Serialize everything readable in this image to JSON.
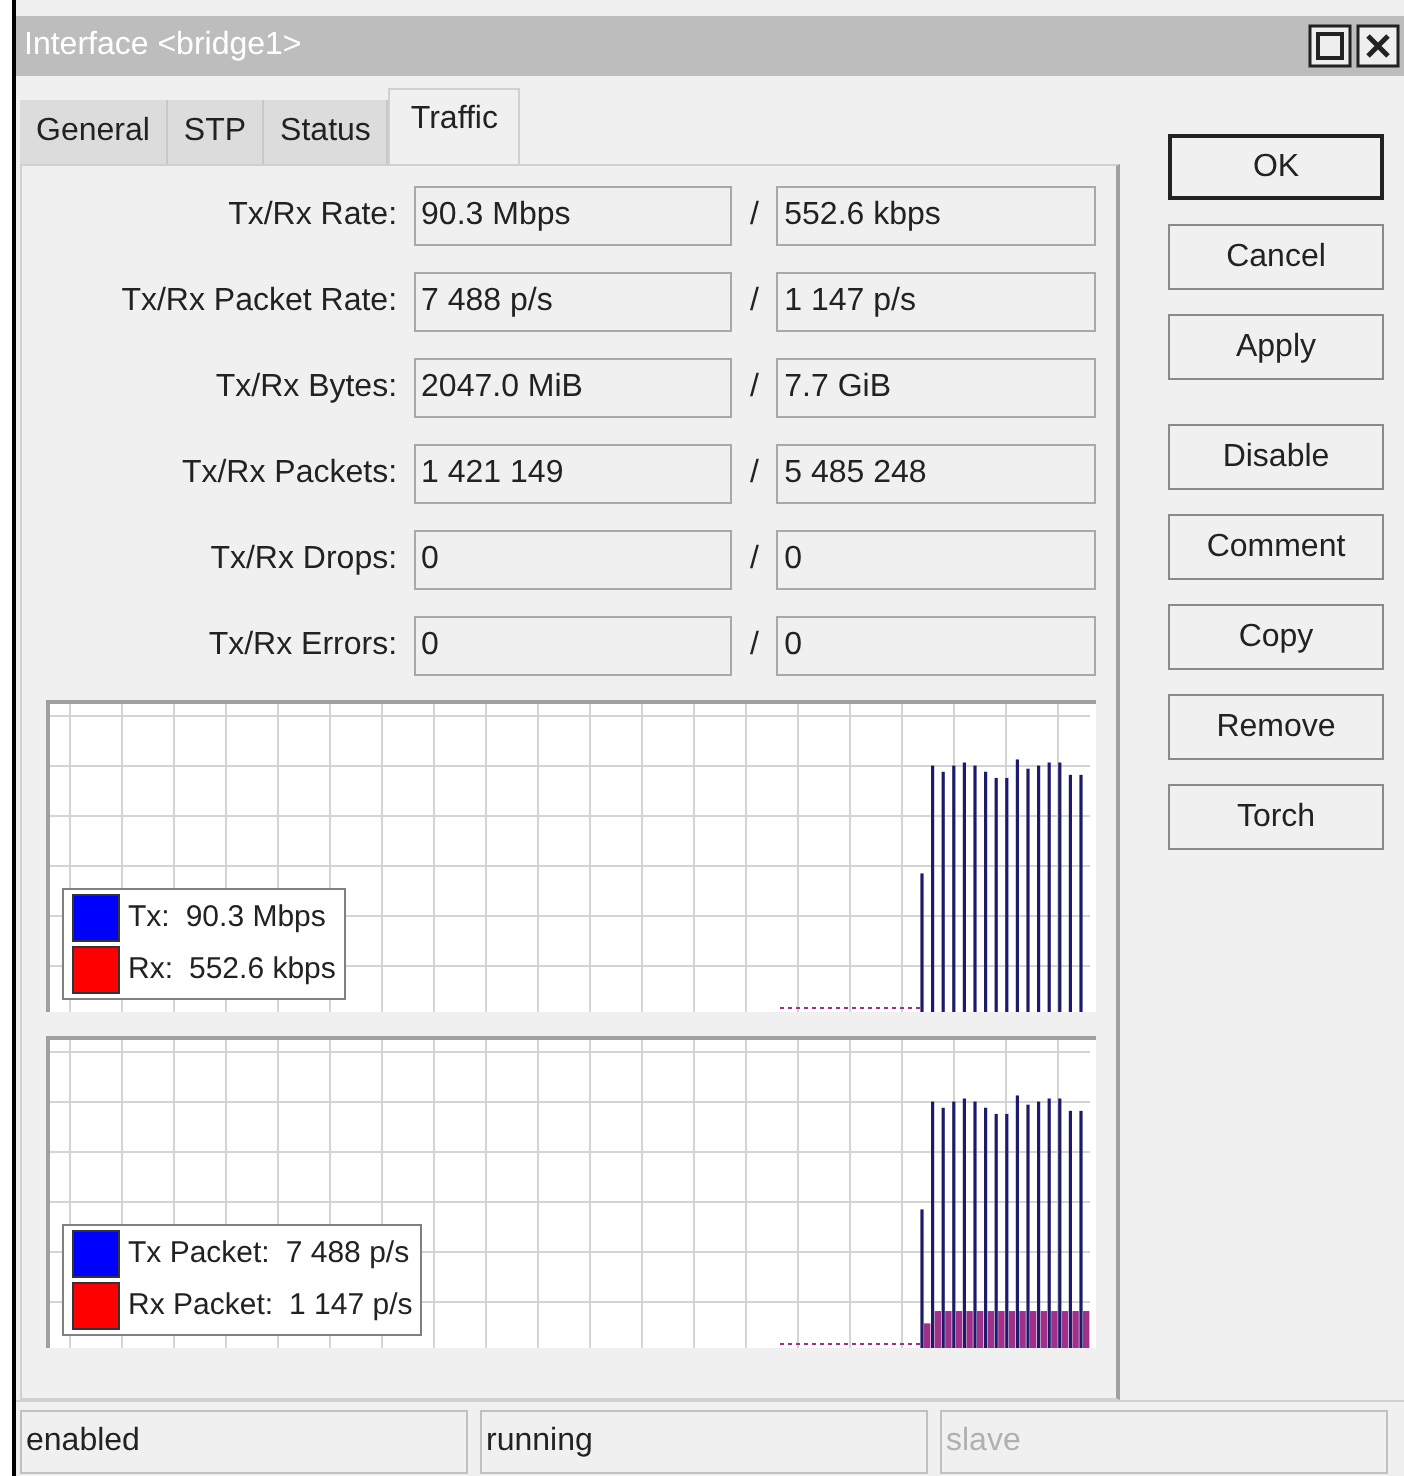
{
  "window": {
    "title": "Interface <bridge1>"
  },
  "tabs": [
    {
      "label": "General",
      "selected": false
    },
    {
      "label": "STP",
      "selected": false
    },
    {
      "label": "Status",
      "selected": false
    },
    {
      "label": "Traffic",
      "selected": true
    }
  ],
  "fields": [
    {
      "label": "Tx/Rx Rate:",
      "tx": "90.3 Mbps",
      "separator": "/",
      "rx": "552.6 kbps"
    },
    {
      "label": "Tx/Rx Packet Rate:",
      "tx": "7 488 p/s",
      "separator": "/",
      "rx": "1 147 p/s"
    },
    {
      "label": "Tx/Rx Bytes:",
      "tx": "2047.0 MiB",
      "separator": "/",
      "rx": "7.7 GiB"
    },
    {
      "label": "Tx/Rx Packets:",
      "tx": "1 421 149",
      "separator": "/",
      "rx": "5 485 248"
    },
    {
      "label": "Tx/Rx Drops:",
      "tx": "0",
      "separator": "/",
      "rx": "0"
    },
    {
      "label": "Tx/Rx Errors:",
      "tx": "0",
      "separator": "/",
      "rx": "0"
    }
  ],
  "graphs": [
    {
      "kind": "rate",
      "legend": [
        {
          "label": "Tx:",
          "value": "90.3 Mbps",
          "color": "#0000ff"
        },
        {
          "label": "Rx:",
          "value": "552.6 kbps",
          "color": "#ff0000"
        }
      ]
    },
    {
      "kind": "packets",
      "legend": [
        {
          "label": "Tx Packet:",
          "value": "7 488 p/s",
          "color": "#0000ff"
        },
        {
          "label": "Rx Packet:",
          "value": "1 147 p/s",
          "color": "#ff0000"
        }
      ]
    }
  ],
  "buttons": [
    {
      "label": "OK",
      "default": true
    },
    {
      "label": "Cancel",
      "default": false
    },
    {
      "label": "Apply",
      "default": false
    },
    {
      "label": "Disable",
      "default": false
    },
    {
      "label": "Comment",
      "default": false
    },
    {
      "label": "Copy",
      "default": false
    },
    {
      "label": "Remove",
      "default": false
    },
    {
      "label": "Torch",
      "default": false
    }
  ],
  "status_bar": [
    {
      "text": "enabled",
      "disabled": false
    },
    {
      "text": "running",
      "disabled": false
    },
    {
      "text": "slave",
      "disabled": true
    }
  ]
}
